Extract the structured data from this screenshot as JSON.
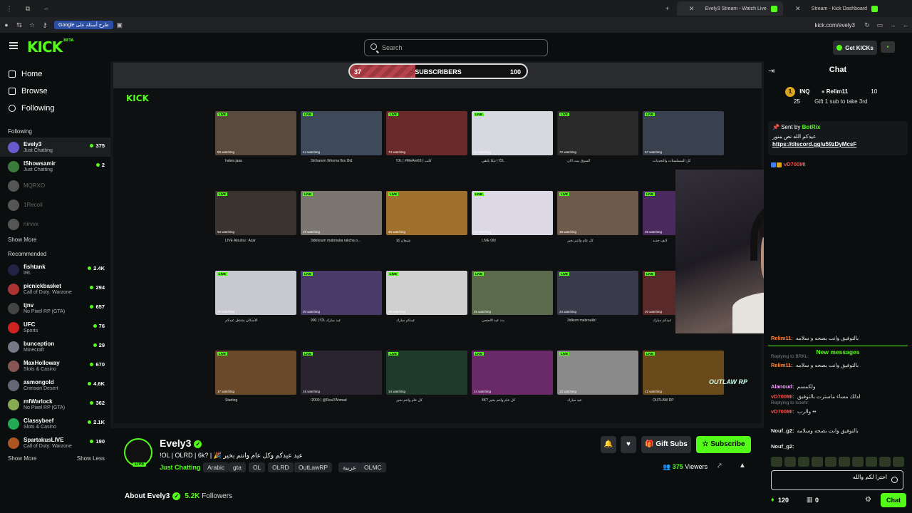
{
  "browser": {
    "tabs": [
      {
        "label": "Evely3 Stream - Watch Live",
        "active": true
      },
      {
        "label": "Stream - Kick Dashboard",
        "active": false
      }
    ],
    "google_pill": "Google طرح أسئلة على",
    "url": "kick.com/evely3"
  },
  "header": {
    "logo": "KICK",
    "logo_beta": "BETA",
    "search_placeholder": "Search",
    "get_kicks": "Get KICKs"
  },
  "sidebar": {
    "nav": [
      "Home",
      "Browse",
      "Following"
    ],
    "following_title": "Following",
    "following": [
      {
        "name": "Evely3",
        "sub": "Just Chatting",
        "viewers": "375",
        "state": "active"
      },
      {
        "name": "lShowsamir",
        "sub": "Just Chatting",
        "viewers": "2",
        "state": "live"
      },
      {
        "name": "MQRXO",
        "sub": "",
        "viewers": "",
        "state": "off"
      },
      {
        "name": "1Recoil",
        "sub": "",
        "viewers": "",
        "state": "off"
      },
      {
        "name": "nirvvx",
        "sub": "",
        "viewers": "",
        "state": "off"
      }
    ],
    "show_more": "Show More",
    "recommended_title": "Recommended",
    "recommended": [
      {
        "name": "fishtank",
        "sub": "IRL",
        "viewers": "2.4K"
      },
      {
        "name": "picnickbasket",
        "sub": "Call of Duty: Warzone",
        "viewers": "294"
      },
      {
        "name": "tjnv",
        "sub": "No Pixel RP (GTA)",
        "viewers": "657"
      },
      {
        "name": "UFC",
        "sub": "Sports",
        "viewers": "76"
      },
      {
        "name": "bunception",
        "sub": "Minecraft",
        "viewers": "29"
      },
      {
        "name": "MaxHolloway",
        "sub": "Slots & Casino",
        "viewers": "670"
      },
      {
        "name": "asmongold",
        "sub": "Crimson Desert",
        "viewers": "4.6K"
      },
      {
        "name": "mfWarlock",
        "sub": "No Pixel RP (GTA)",
        "viewers": "362"
      },
      {
        "name": "Classybeef",
        "sub": "Slots & Casino",
        "viewers": "2.1K"
      },
      {
        "name": "SpartakusLIVE",
        "sub": "Call of Duty: Warzone",
        "viewers": "190"
      }
    ],
    "show_more_2": "Show More",
    "show_less": "Show Less"
  },
  "stream": {
    "sub_goal": {
      "current": "37",
      "label": "SUBSCRIBERS",
      "goal": "100",
      "progress": 0.37
    },
    "overlay_brand": "OUTLAW RP",
    "thumbs": [
      {
        "w": "90 watching",
        "t": "halwa jaaa"
      },
      {
        "w": "44 watching",
        "t": "3id karem firhoma flos l3id"
      },
      {
        "w": "74 watching",
        "t": "!OL | #WeAre63 | كاتب"
      },
      {
        "w": "82 watching",
        "t": "تيكا يلتقي | !OL"
      },
      {
        "w": "72 watching",
        "t": "السوق بيت الان"
      },
      {
        "w": "67 watching",
        "t": "كل المسلسلات والتحديات"
      },
      {
        "w": "53 watching",
        "t": "LIVE Aloulou : Azar"
      },
      {
        "w": "49 watching",
        "t": "3idekoum mabrouka rakcha o..."
      },
      {
        "w": "45 watching",
        "t": "شبعان كلا"
      },
      {
        "w": "44 watching",
        "t": "LIVE ON"
      },
      {
        "w": "38 watching",
        "t": "كل عام وانتم بخير"
      },
      {
        "w": "38 watching",
        "t": "لايف جديد"
      },
      {
        "w": "36 watching",
        "t": "الأسكان يشتغل عيدكم"
      },
      {
        "w": "30 watching",
        "t": "900 | !OL عيد مبارك"
      },
      {
        "w": "28 watching",
        "t": "عيدكم مبارك"
      },
      {
        "w": "25 watching",
        "t": "بث عيد الاضحى"
      },
      {
        "w": "24 watching",
        "t": "3idkom mabroukk!"
      },
      {
        "w": "20 watching",
        "t": "عيدكم مبارك"
      },
      {
        "w": "17 watching",
        "t": "Starting"
      },
      {
        "w": "15 watching",
        "t": "!2000 | @Real7Ahmad"
      },
      {
        "w": "14 watching",
        "t": "كل عام وانتم بخير"
      },
      {
        "w": "14 watching",
        "t": "4K? كل عام وانتم بخير"
      },
      {
        "w": "12 watching",
        "t": "عيد مبارك"
      },
      {
        "w": "12 watching",
        "t": "OUTLAW RP"
      }
    ]
  },
  "chat": {
    "title": "Chat",
    "leaderboard": {
      "rank": "1",
      "user1": "INQ",
      "count1": "25",
      "user2": "Relim11",
      "count2": "10",
      "note": "Gift 1 sub to take 3rd"
    },
    "pinned": {
      "sent_by": "Sent by",
      "bot": "BotRix",
      "message": "عيدكم الله نص منور",
      "link": "https://discord.gg/u59zDyMcsF",
      "user": "vD700MI"
    },
    "messages": [
      {
        "user": "Relim11:",
        "text": "بالتوفيق وانت بصحه و سلامه",
        "reply": ""
      },
      {
        "user": "Relim11:",
        "text": "بالتوفيق وانت بصحه و سلامه",
        "reply": "Replying to BRKL:"
      },
      {
        "user": "Alanoud:",
        "text": "ولكمسم",
        "reply": ""
      },
      {
        "user": "vD700MI:",
        "text": "لذلك مساء ماسترت بالتوفيق",
        "reply": ""
      },
      {
        "user": "vD700MI:",
        "text": "والرب ••",
        "reply": "Replying to lsoehr:"
      },
      {
        "user": "Nouf_g2:",
        "text": "بالتوفيق وانت بصحه وسلامه",
        "reply": ""
      },
      {
        "user": "Nouf_g2:",
        "text": "",
        "reply": ""
      }
    ],
    "new_messages": "New messages",
    "input_value": "احترا لكم والله",
    "kicks": "120",
    "points": "0",
    "send": "Chat"
  },
  "channel": {
    "name": "Evely3",
    "title": "!OL | OLRD | 6k? | 🎉 عيد عيدكم وكل عام وانتم بخير",
    "category": "Just Chatting",
    "tags": [
      "Arabic",
      "gta",
      "OL",
      "OLRD",
      "OutLawRP",
      "عربية",
      "OLMC"
    ],
    "live_badge": "LIVE",
    "viewers": "375",
    "viewers_label": "Viewers",
    "gift_subs": "Gift Subs",
    "subscribe": "Subscribe",
    "about": "About Evely3",
    "followers_count": "5.2K",
    "followers_label": "Followers"
  },
  "colors": {
    "brand": "#53fc18",
    "bg": "#0b0e0f"
  }
}
